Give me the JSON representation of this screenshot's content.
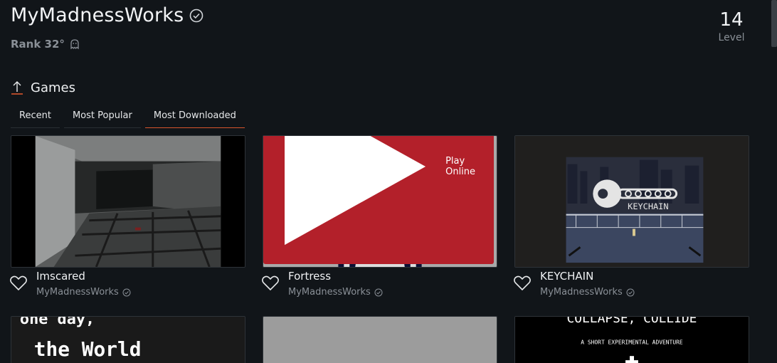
{
  "profile": {
    "name": "MyMadnessWorks",
    "rank": "Rank 32°",
    "level_value": "14",
    "level_label": "Level"
  },
  "section": {
    "title": "Games"
  },
  "tabs": [
    {
      "label": "Recent"
    },
    {
      "label": "Most Popular"
    },
    {
      "label": "Most Downloaded",
      "active": true
    }
  ],
  "games": [
    {
      "title": "Imscared",
      "author": "MyMadnessWorks"
    },
    {
      "title": "Fortress",
      "author": "MyMadnessWorks",
      "play_label": "Play Online"
    },
    {
      "title": "KEYCHAIN",
      "author": "MyMadnessWorks",
      "art_text": "KEYCHAIN"
    }
  ],
  "second_row_art": {
    "left_line1": "one day,",
    "left_line2": "the World",
    "right_title": "COLLAPSE, COLLIDE",
    "right_subtitle": "A SHORT EXPERIMENTAL ADVENTURE"
  },
  "colors": {
    "background": "#111519",
    "accent_tab": "#d8552c",
    "play_button": "#b3202a",
    "muted_text": "#8a9097"
  }
}
